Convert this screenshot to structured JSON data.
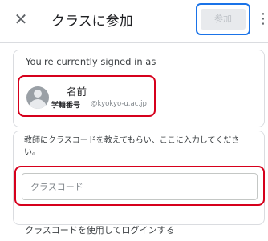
{
  "header": {
    "close_icon": "close-icon",
    "title": "クラスに参加",
    "join_label": "参加",
    "more_icon": "more-vert-icon"
  },
  "account": {
    "signed_in_label": "You're currently signed in as",
    "name": "名前",
    "student_id_label": "学籍番号",
    "domain": "@kyokyo-u.ac.jp",
    "avatar_icon": "avatar-placeholder-icon"
  },
  "class_code": {
    "instruction": "教師にクラスコードを教えてもらい、ここに入力してください。",
    "input_value": "",
    "placeholder": "クラスコード"
  },
  "footer": {
    "login_with_code": "クラスコードを使用してログインする"
  },
  "colors": {
    "highlight_red": "#d6001c",
    "highlight_blue": "#1a73e8",
    "join_disabled_bg": "#e8eaed"
  }
}
